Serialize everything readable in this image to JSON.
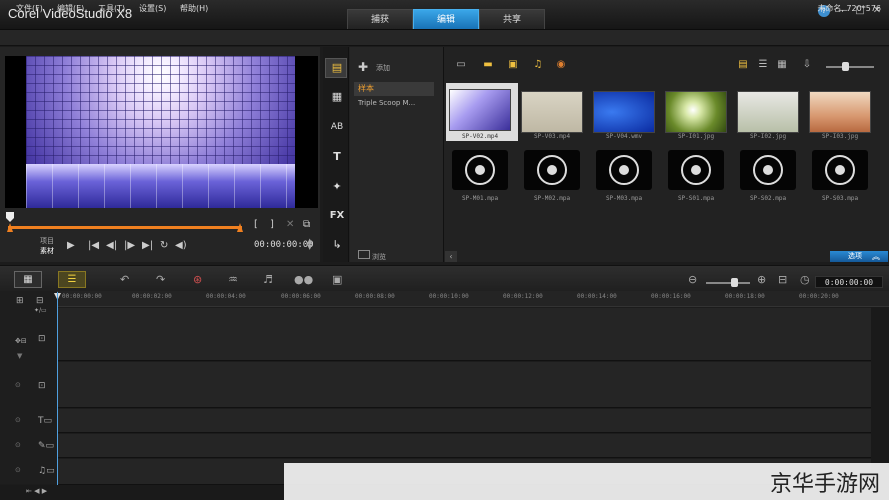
{
  "app": {
    "title": "Corel  VideoStudio X8"
  },
  "main_tabs": [
    {
      "label": "捕获",
      "active": false
    },
    {
      "label": "编辑",
      "active": true
    },
    {
      "label": "共享",
      "active": false
    }
  ],
  "window_buttons": {
    "help": "?",
    "minimize": "—",
    "maximize": "□",
    "close": "✕"
  },
  "menu": [
    "文件(F)",
    "编辑(E)",
    "工具(T)",
    "设置(S)",
    "帮助(H)"
  ],
  "project_info": "未命名, 720*576",
  "player": {
    "project_label": "项目",
    "clip_label": "素材",
    "mark_in": "[",
    "mark_out": "]",
    "timecode": "00:00:00:00",
    "controls": [
      "▶",
      "|◀",
      "◀|",
      "|▶",
      "▶|",
      "↻",
      "◀)"
    ]
  },
  "library": {
    "add_label": "添加",
    "folders": [
      {
        "label": "样本",
        "active": true
      },
      {
        "label": "Triple Scoop M..."
      }
    ],
    "browse_label": "浏览",
    "options_label": "选项",
    "items": [
      {
        "label": "SP-V02.mp4",
        "kind": "video",
        "selected": true
      },
      {
        "label": "SP-V03.mp4",
        "kind": "video"
      },
      {
        "label": "SP-V04.wmv",
        "kind": "video"
      },
      {
        "label": "SP-I01.jpg",
        "kind": "image"
      },
      {
        "label": "SP-I02.jpg",
        "kind": "image"
      },
      {
        "label": "SP-I03.jpg",
        "kind": "image"
      },
      {
        "label": "SP-M01.mpa",
        "kind": "audio"
      },
      {
        "label": "SP-M02.mpa",
        "kind": "audio"
      },
      {
        "label": "SP-M03.mpa",
        "kind": "audio"
      },
      {
        "label": "SP-S01.mpa",
        "kind": "audio"
      },
      {
        "label": "SP-S02.mpa",
        "kind": "audio"
      },
      {
        "label": "SP-S03.mpa",
        "kind": "audio"
      }
    ]
  },
  "side_tools": [
    "media-icon",
    "instant-project-icon",
    "transition-icon",
    "title-icon",
    "graphic-icon",
    "filter-icon",
    "path-icon"
  ],
  "side_text": {
    "title": "T",
    "filter": "FX",
    "transition": "AB"
  },
  "timeline": {
    "timecode": "0:00:00:00",
    "ruler": [
      "00:00:00:00",
      "00:00:02:00",
      "00:00:04:00",
      "00:00:06:00",
      "00:00:08:00",
      "00:00:10:00",
      "00:00:12:00",
      "00:00:14:00",
      "00:00:16:00",
      "00:00:18:00",
      "00:00:20:00"
    ]
  },
  "watermark": "京华手游网",
  "colors": {
    "accent_blue": "#2a8ad4",
    "orange": "#f08020",
    "active_folder": "#f0a030"
  }
}
